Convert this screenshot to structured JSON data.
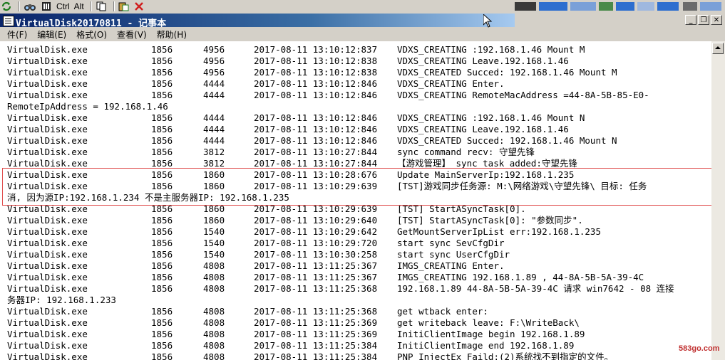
{
  "toolbar": {
    "items": [
      {
        "name": "refresh-icon",
        "glyph": "⟳"
      },
      {
        "name": "binoculars-icon",
        "glyph": "⛭"
      },
      {
        "name": "book-icon",
        "glyph": "▥"
      },
      {
        "name": "ctrl-label",
        "text": "Ctrl"
      },
      {
        "name": "alt-label",
        "text": "Alt"
      },
      {
        "name": "copy-icon",
        "glyph": "⎘"
      },
      {
        "name": "paste-icon",
        "glyph": "⎗"
      },
      {
        "name": "close-red-icon",
        "glyph": "✕"
      }
    ],
    "ctrl": "Ctrl",
    "alt": "Alt"
  },
  "window": {
    "title": "VirtualDisk20170811 - 记事本",
    "minimize": "_",
    "restore": "❐",
    "close": "✕"
  },
  "menu": [
    "件(F)",
    "编辑(E)",
    "格式(O)",
    "查看(V)",
    "帮助(H)"
  ],
  "log": {
    "rows": [
      {
        "proc": "VirtualDisk.exe",
        "pid": "1856",
        "tid": "4956",
        "time": "2017-08-11 13:10:12:837",
        "msg": "VDXS_CREATING :192.168.1.46 Mount M"
      },
      {
        "proc": "VirtualDisk.exe",
        "pid": "1856",
        "tid": "4956",
        "time": "2017-08-11 13:10:12:838",
        "msg": "VDXS_CREATING Leave.192.168.1.46"
      },
      {
        "proc": "VirtualDisk.exe",
        "pid": "1856",
        "tid": "4956",
        "time": "2017-08-11 13:10:12:838",
        "msg": "VDXS_CREATED Succed: 192.168.1.46 Mount M"
      },
      {
        "proc": "VirtualDisk.exe",
        "pid": "1856",
        "tid": "4444",
        "time": "2017-08-11 13:10:12:846",
        "msg": "VDXS_CREATING Enter."
      },
      {
        "proc": "VirtualDisk.exe",
        "pid": "1856",
        "tid": "4444",
        "time": "2017-08-11 13:10:12:846",
        "msg": "VDXS_CREATING RemoteMacAddress =44-8A-5B-85-E0-"
      },
      {
        "cont": "RemoteIpAddress  = 192.168.1.46"
      },
      {
        "proc": "VirtualDisk.exe",
        "pid": "1856",
        "tid": "4444",
        "time": "2017-08-11 13:10:12:846",
        "msg": "VDXS_CREATING :192.168.1.46 Mount N"
      },
      {
        "proc": "VirtualDisk.exe",
        "pid": "1856",
        "tid": "4444",
        "time": "2017-08-11 13:10:12:846",
        "msg": "VDXS_CREATING Leave.192.168.1.46"
      },
      {
        "proc": "VirtualDisk.exe",
        "pid": "1856",
        "tid": "4444",
        "time": "2017-08-11 13:10:12:846",
        "msg": "VDXS_CREATED Succed: 192.168.1.46 Mount N"
      },
      {
        "proc": "VirtualDisk.exe",
        "pid": "1856",
        "tid": "3812",
        "time": "2017-08-11 13:10:27:844",
        "msg": "sync command recv: 守望先锋"
      },
      {
        "proc": "VirtualDisk.exe",
        "pid": "1856",
        "tid": "3812",
        "time": "2017-08-11 13:10:27:844",
        "msg": "【游戏管理】     sync task added:守望先锋"
      },
      {
        "proc": "VirtualDisk.exe",
        "pid": "1856",
        "tid": "1860",
        "time": "2017-08-11 13:10:28:676",
        "msg": "Update MainServerIp:192.168.1.235"
      },
      {
        "proc": "VirtualDisk.exe",
        "pid": "1856",
        "tid": "1860",
        "time": "2017-08-11 13:10:29:639",
        "msg": "[TST]游戏同步任务源:  M:\\网络游戏\\守望先锋\\ 目标:  任务"
      },
      {
        "cont": "消, 因为源IP:192.168.1.234 不是主服务器IP: 192.168.1.235"
      },
      {
        "proc": "VirtualDisk.exe",
        "pid": "1856",
        "tid": "1860",
        "time": "2017-08-11 13:10:29:639",
        "msg": "[TST] StartASyncTask[0]."
      },
      {
        "proc": "VirtualDisk.exe",
        "pid": "1856",
        "tid": "1860",
        "time": "2017-08-11 13:10:29:640",
        "msg": "[TST] StartASyncTask[0]: \"参数同步\"."
      },
      {
        "proc": "VirtualDisk.exe",
        "pid": "1856",
        "tid": "1540",
        "time": "2017-08-11 13:10:29:642",
        "msg": "GetMountServerIpList err:192.168.1.235"
      },
      {
        "proc": "VirtualDisk.exe",
        "pid": "1856",
        "tid": "1540",
        "time": "2017-08-11 13:10:29:720",
        "msg": "start sync SevCfgDir"
      },
      {
        "proc": "VirtualDisk.exe",
        "pid": "1856",
        "tid": "1540",
        "time": "2017-08-11 13:10:30:258",
        "msg": "start sync UserCfgDir"
      },
      {
        "proc": "VirtualDisk.exe",
        "pid": "1856",
        "tid": "4808",
        "time": "2017-08-11 13:11:25:367",
        "msg": "IMGS_CREATING Enter."
      },
      {
        "proc": "VirtualDisk.exe",
        "pid": "1856",
        "tid": "4808",
        "time": "2017-08-11 13:11:25:367",
        "msg": "IMGS_CREATING 192.168.1.89 , 44-8A-5B-5A-39-4C"
      },
      {
        "proc": "VirtualDisk.exe",
        "pid": "1856",
        "tid": "4808",
        "time": "2017-08-11 13:11:25:368",
        "msg": "192.168.1.89 44-8A-5B-5A-39-4C  请求 win7642 - 08 连接"
      },
      {
        "cont": "务器IP: 192.168.1.233"
      },
      {
        "proc": "VirtualDisk.exe",
        "pid": "1856",
        "tid": "4808",
        "time": "2017-08-11 13:11:25:368",
        "msg": "get wtback enter:"
      },
      {
        "proc": "VirtualDisk.exe",
        "pid": "1856",
        "tid": "4808",
        "time": "2017-08-11 13:11:25:369",
        "msg": "get writeback leave: F:\\WriteBack\\"
      },
      {
        "proc": "VirtualDisk.exe",
        "pid": "1856",
        "tid": "4808",
        "time": "2017-08-11 13:11:25:369",
        "msg": "InitiClientImage begin 192.168.1.89"
      },
      {
        "proc": "VirtualDisk.exe",
        "pid": "1856",
        "tid": "4808",
        "time": "2017-08-11 13:11:25:384",
        "msg": "InitiClientImage end 192.168.1.89"
      },
      {
        "proc": "VirtualDisk.exe",
        "pid": "1856",
        "tid": "4808",
        "time": "2017-08-11 13:11:25:384",
        "msg": "PNP InjectEx Faild:(2)系统找不到指定的文件。"
      }
    ]
  },
  "watermark": "583go.com"
}
